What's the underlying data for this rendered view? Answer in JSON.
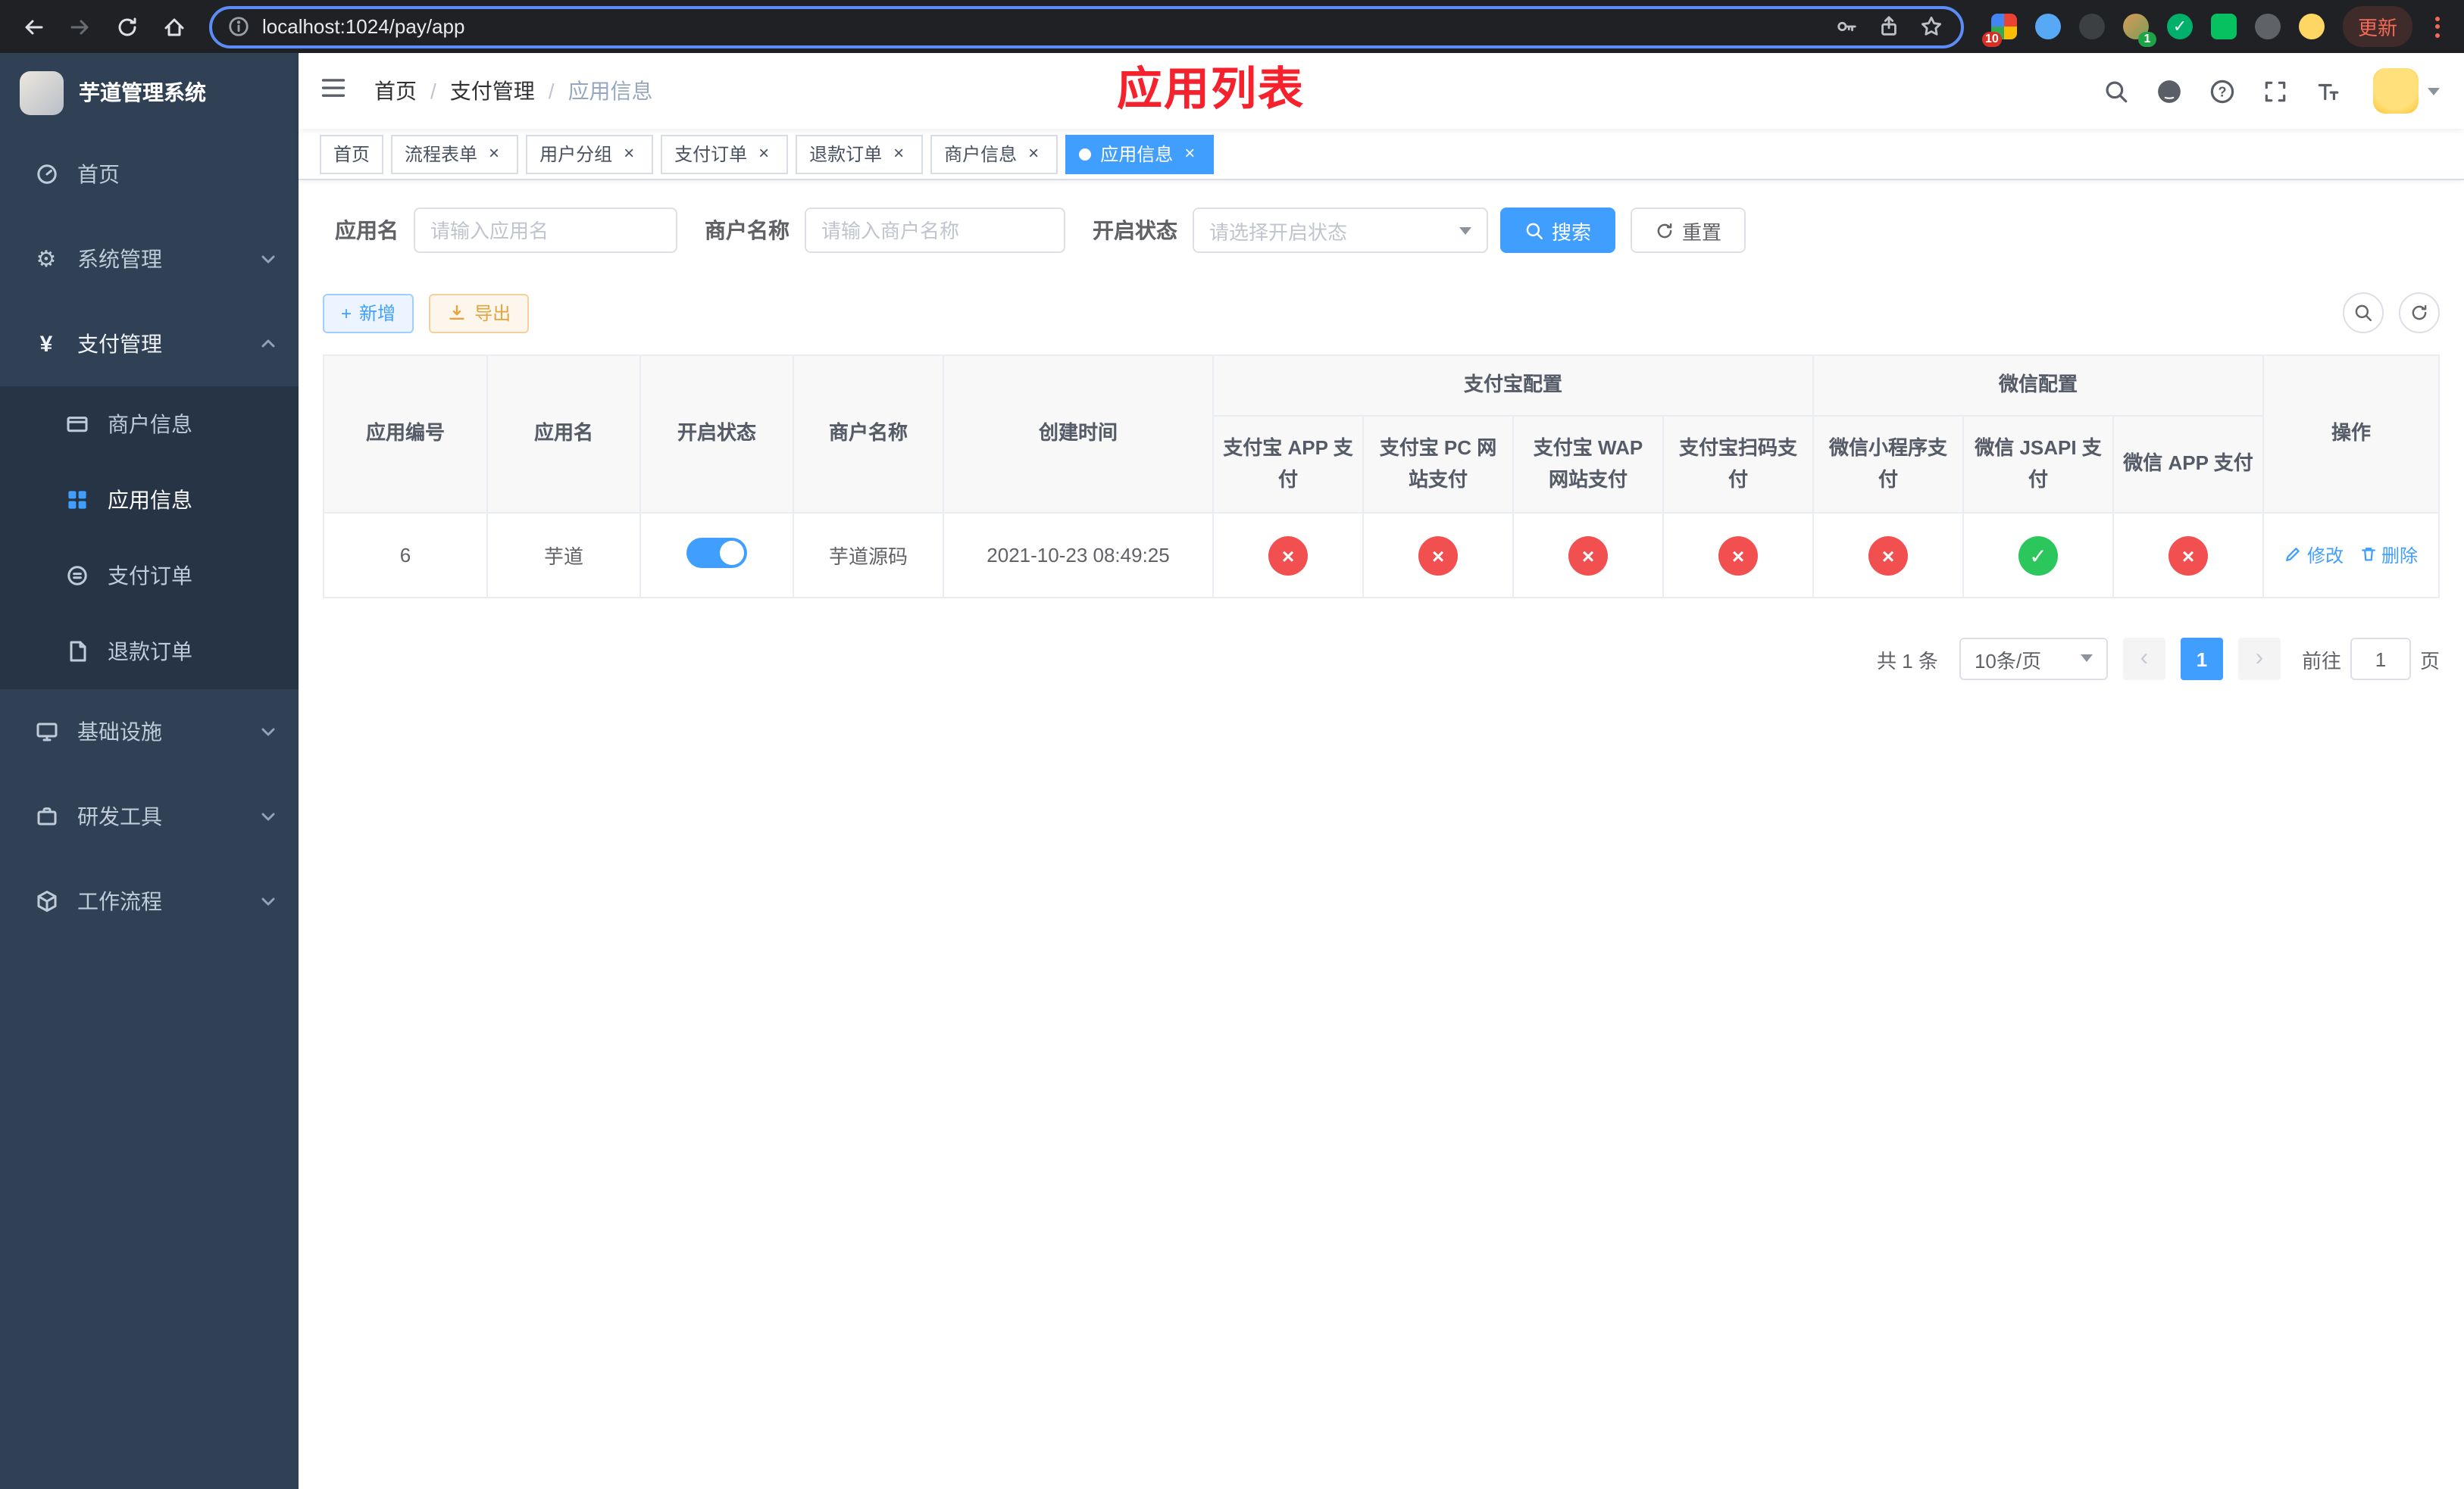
{
  "browser": {
    "url": "localhost:1024/pay/app",
    "update_label": "更新",
    "badge_extensions": "10",
    "badge_profile": "1"
  },
  "icons": {
    "cross": "×",
    "check": "✓",
    "close": "×",
    "plus": "+",
    "prev": "‹",
    "next": "›",
    "gear": "⚙",
    "yen": "¥"
  },
  "sidebar": {
    "title": "芋道管理系统",
    "menu": {
      "home": "首页",
      "system": "系统管理",
      "payment": "支付管理",
      "merchant_info": "商户信息",
      "app_info": "应用信息",
      "pay_orders": "支付订单",
      "refund_orders": "退款订单",
      "infrastructure": "基础设施",
      "dev_tools": "研发工具",
      "workflow": "工作流程"
    }
  },
  "breadcrumb": {
    "home": "首页",
    "section": "支付管理",
    "current": "应用信息",
    "separator": "/"
  },
  "annotation": "应用列表",
  "tabs": [
    {
      "label": "首页",
      "closable": false,
      "active": false
    },
    {
      "label": "流程表单",
      "closable": true,
      "active": false
    },
    {
      "label": "用户分组",
      "closable": true,
      "active": false
    },
    {
      "label": "支付订单",
      "closable": true,
      "active": false
    },
    {
      "label": "退款订单",
      "closable": true,
      "active": false
    },
    {
      "label": "商户信息",
      "closable": true,
      "active": false
    },
    {
      "label": "应用信息",
      "closable": true,
      "active": true
    }
  ],
  "filters": {
    "app_name_label": "应用名",
    "app_name_placeholder": "请输入应用名",
    "merchant_label": "商户名称",
    "merchant_placeholder": "请输入商户名称",
    "status_label": "开启状态",
    "status_placeholder": "请选择开启状态",
    "search": "搜索",
    "reset": "重置"
  },
  "toolbar": {
    "add": "新增",
    "export": "导出"
  },
  "table": {
    "col_app_id": "应用编号",
    "col_app_name": "应用名",
    "col_status": "开启状态",
    "col_merchant": "商户名称",
    "col_created": "创建时间",
    "group_alipay": "支付宝配置",
    "group_wechat": "微信配置",
    "col_alipay_app": "支付宝 APP 支付",
    "col_alipay_pc": "支付宝 PC 网站支付",
    "col_alipay_wap": "支付宝 WAP 网站支付",
    "col_alipay_qr": "支付宝扫码支付",
    "col_wx_lite": "微信小程序支付",
    "col_wx_jsapi": "微信 JSAPI 支付",
    "col_wx_app": "微信 APP 支付",
    "col_actions": "操作",
    "row": {
      "app_id": "6",
      "app_name": "芋道",
      "enabled": true,
      "merchant": "芋道源码",
      "created": "2021-10-23 08:49:25",
      "alipay_app": false,
      "alipay_pc": false,
      "alipay_wap": false,
      "alipay_qr": false,
      "wx_lite": false,
      "wx_jsapi": true,
      "wx_app": false,
      "edit": "修改",
      "delete": "删除"
    }
  },
  "pagination": {
    "total": "共 1 条",
    "page_size": "10条/页",
    "page": "1",
    "goto_label": "前往",
    "goto_value": "1",
    "goto_unit": "页"
  }
}
